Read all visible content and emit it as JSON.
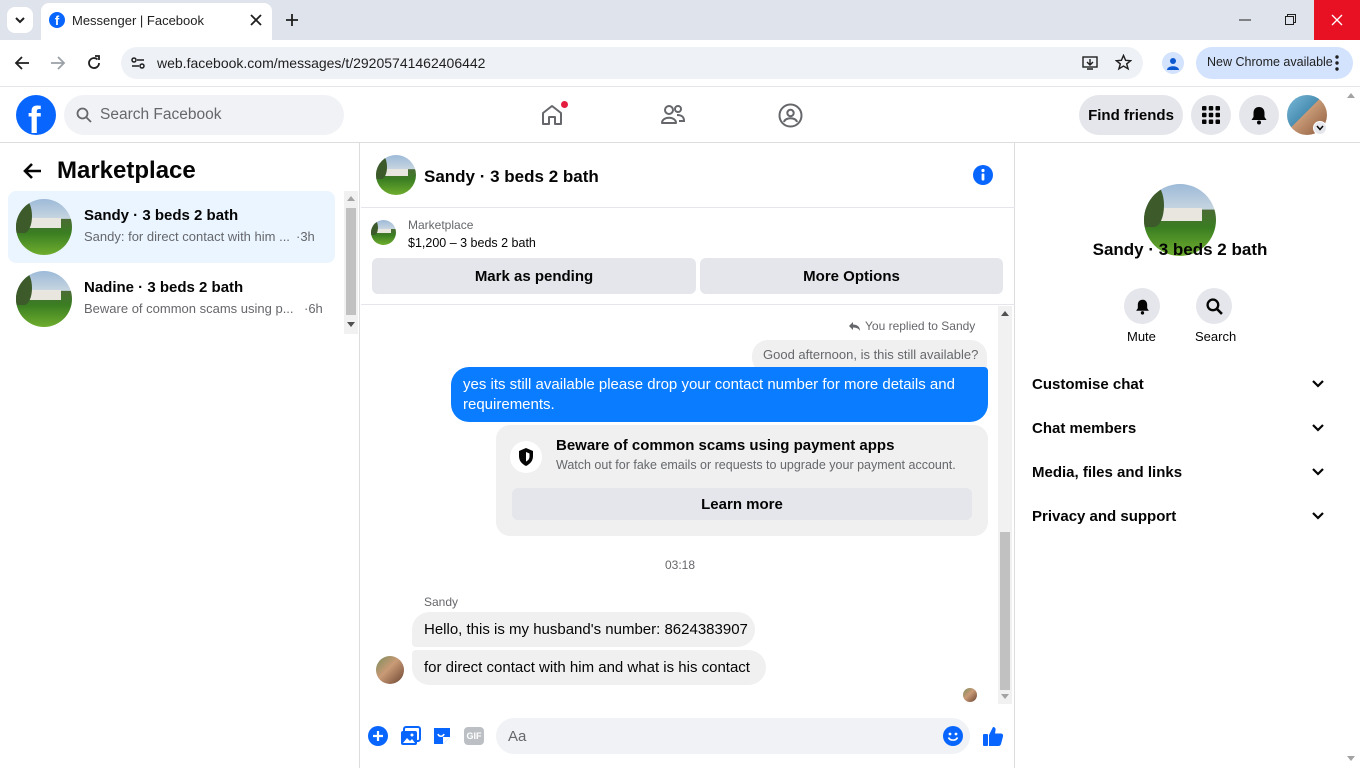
{
  "browser": {
    "tab_title": "Messenger | Facebook",
    "url": "web.facebook.com/messages/t/29205741462406442",
    "update_button": "New Chrome available"
  },
  "fb": {
    "search_placeholder": "Search Facebook",
    "find_friends": "Find friends"
  },
  "left": {
    "title": "Marketplace",
    "conversations": [
      {
        "name": "Sandy · 3 beds 2 bath",
        "preview": "Sandy: for direct contact with him ...",
        "time": "·3h",
        "active": true
      },
      {
        "name": "Nadine · 3 beds 2 bath",
        "preview": "Beware of common scams using p...",
        "time": "·6h",
        "active": false
      }
    ]
  },
  "chat": {
    "title": "Sandy · 3 beds 2 bath",
    "listing_source": "Marketplace",
    "listing_detail": "$1,200 – 3 beds 2 bath",
    "mark_pending": "Mark as pending",
    "more_options": "More Options",
    "replied_to": "You replied to Sandy",
    "quoted_message": "Good afternoon, is this still available?",
    "my_message": "yes its still available please drop your contact number for more details and requirements.",
    "scam_title": "Beware of common scams using payment apps",
    "scam_body": "Watch out for fake emails or requests to upgrade your payment account.",
    "learn_more": "Learn more",
    "timestamp": "03:18",
    "sender": "Sandy",
    "msg1": "Hello, this is my husband's number: 8624383907",
    "msg2": "for direct contact with him and what is his contact",
    "composer_placeholder": "Aa",
    "gif_label": "GIF"
  },
  "right": {
    "name": "Sandy · 3 beds 2 bath",
    "mute": "Mute",
    "search": "Search",
    "sections": [
      "Customise chat",
      "Chat members",
      "Media, files and links",
      "Privacy and support"
    ]
  },
  "colors": {
    "fb_blue": "#0866ff",
    "bubble_blue": "#0a7cff",
    "active_conv": "#ebf5ff"
  }
}
